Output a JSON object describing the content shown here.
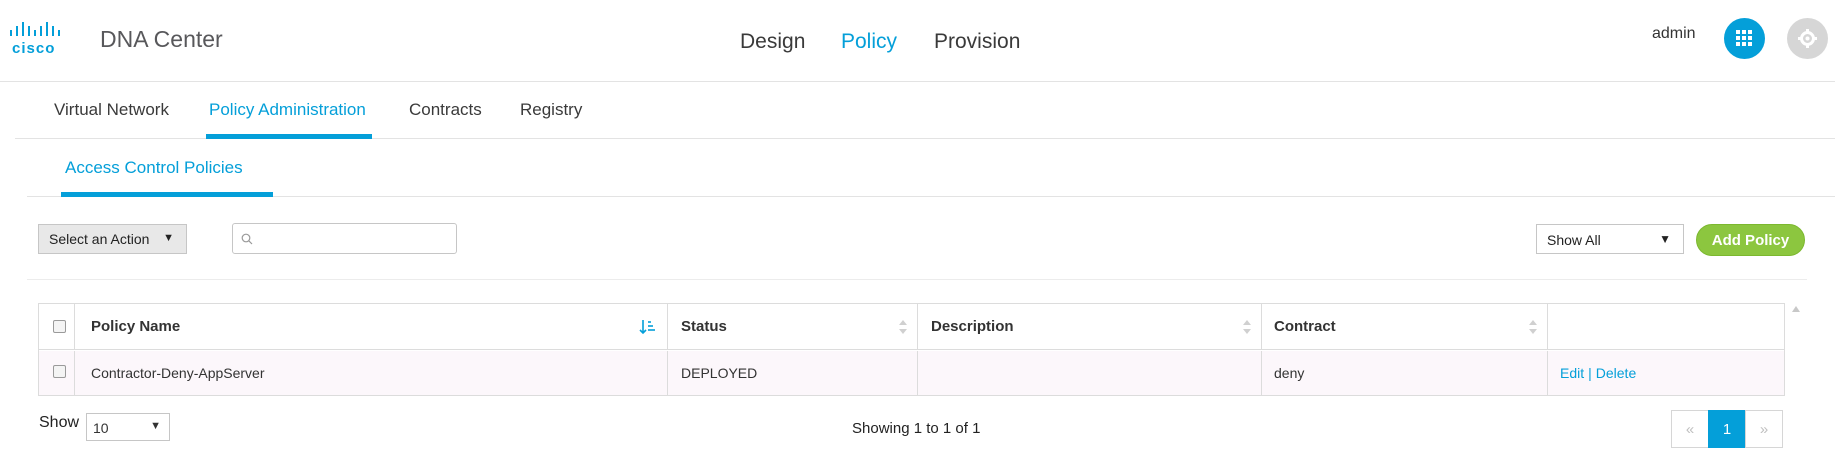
{
  "header": {
    "logo_text": "cisco",
    "app_title": "DNA Center",
    "nav": [
      "Design",
      "Policy",
      "Provision"
    ],
    "active_nav": "Policy",
    "user": "admin",
    "accent_color": "#049fd9"
  },
  "tabs": {
    "items": [
      "Virtual Network",
      "Policy Administration",
      "Contracts",
      "Registry"
    ],
    "active": "Policy Administration"
  },
  "subtabs": {
    "items": [
      "Access Control Policies"
    ],
    "active": "Access Control Policies"
  },
  "toolbar": {
    "action_select": "Select an Action",
    "search_placeholder": "",
    "filter_select": "Show All",
    "add_button": "Add Policy",
    "add_button_color": "#8cc63f"
  },
  "table": {
    "columns": [
      "Policy Name",
      "Status",
      "Description",
      "Contract",
      ""
    ],
    "rows": [
      {
        "policy_name": "Contractor-Deny-AppServer",
        "status": "DEPLOYED",
        "description": "",
        "contract": "deny",
        "actions": [
          "Edit",
          "Delete"
        ]
      }
    ]
  },
  "footer": {
    "show_label": "Show",
    "page_size": "10",
    "showing_text": "Showing 1 to 1 of 1",
    "prev": "«",
    "current_page": "1",
    "next": "»"
  }
}
